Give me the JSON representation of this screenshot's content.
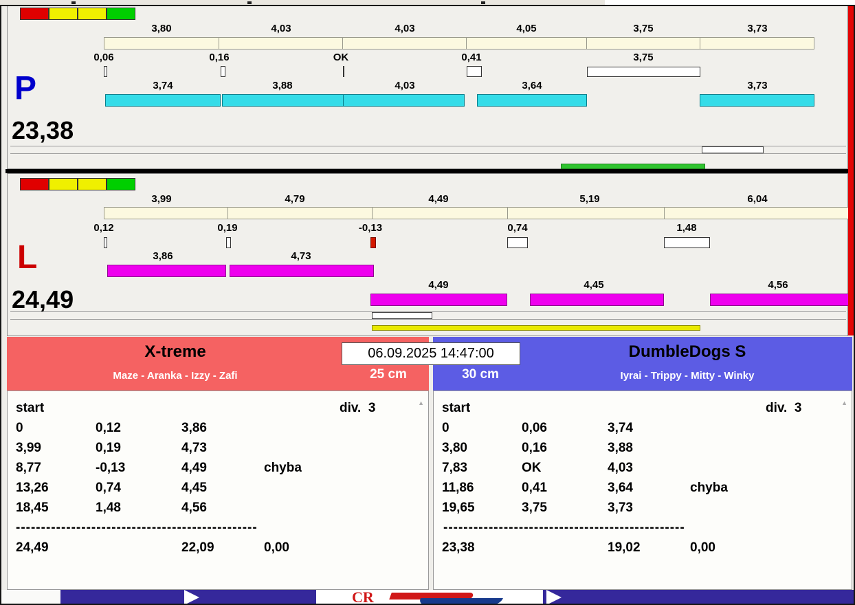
{
  "lane_p": {
    "label": "P",
    "total": "23,38",
    "lights": [
      "red",
      "yellow",
      "yellow",
      "green"
    ],
    "splits": [
      "3,80",
      "4,03",
      "4,03",
      "4,05",
      "3,75",
      "3,73"
    ],
    "marks": [
      "0,06",
      "0,16",
      "OK",
      "0,41",
      "3,75"
    ],
    "runs": [
      "3,74",
      "3,88",
      "4,03",
      "3,64",
      "3,73"
    ]
  },
  "lane_l": {
    "label": "L",
    "total": "24,49",
    "lights": [
      "red",
      "yellow",
      "yellow",
      "green"
    ],
    "splits": [
      "3,99",
      "4,79",
      "4,49",
      "5,19",
      "6,04"
    ],
    "marks": [
      "0,12",
      "0,19",
      "-0,13",
      "0,74",
      "1,48"
    ],
    "runs_a": [
      "3,86",
      "4,73"
    ],
    "runs_b": [
      "4,49",
      "4,45",
      "4,56"
    ]
  },
  "datetime": "06.09.2025 14:47:00",
  "team_left": {
    "name": "X-treme",
    "dogs": "Maze - Aranka - Izzy - Zafi",
    "jump_height": "25 cm",
    "start_label": "start",
    "division": "div.  3",
    "rows": [
      {
        "c1": "0",
        "c2": "0,12",
        "c3": "3,86",
        "c4": ""
      },
      {
        "c1": "3,99",
        "c2": "0,19",
        "c3": "4,73",
        "c4": ""
      },
      {
        "c1": "8,77",
        "c2": "-0,13",
        "c3": "4,49",
        "c4": "chyba"
      },
      {
        "c1": "13,26",
        "c2": "0,74",
        "c3": "4,45",
        "c4": ""
      },
      {
        "c1": "18,45",
        "c2": "1,48",
        "c3": "4,56",
        "c4": ""
      }
    ],
    "dashes": "------------------------------------------------",
    "total": "24,49",
    "sum": "22,09",
    "penalty": "0,00"
  },
  "team_right": {
    "name": "DumbleDogs S",
    "dogs": "Iyrai - Trippy - Mitty - Winky",
    "jump_height": "30 cm",
    "start_label": "start",
    "division": "div.  3",
    "rows": [
      {
        "c1": "0",
        "c2": "0,06",
        "c3": "3,74",
        "c4": ""
      },
      {
        "c1": "3,80",
        "c2": "0,16",
        "c3": "3,88",
        "c4": ""
      },
      {
        "c1": "7,83",
        "c2": "OK",
        "c3": "4,03",
        "c4": ""
      },
      {
        "c1": "11,86",
        "c2": "0,41",
        "c3": "3,64",
        "c4": "chyba"
      },
      {
        "c1": "19,65",
        "c2": "3,75",
        "c3": "3,73",
        "c4": ""
      }
    ],
    "dashes": "------------------------------------------------",
    "total": "23,38",
    "sum": "19,02",
    "penalty": "0,00"
  },
  "banner": {
    "logo_text": "CR"
  },
  "colors": {
    "cyan_bar": "#35dce8",
    "magenta_bar": "#ee00ee",
    "cream_segment": "#fcf9e0",
    "green_progress": "#2fc42f",
    "yellow_progress": "#e9e900",
    "red_header": "#f56262",
    "blue_header": "#5c5ce4",
    "lane_p_letter": "#0000cc",
    "lane_l_letter": "#cc0000",
    "banner_purple": "#35289b",
    "right_strip_red": "#e30505"
  }
}
